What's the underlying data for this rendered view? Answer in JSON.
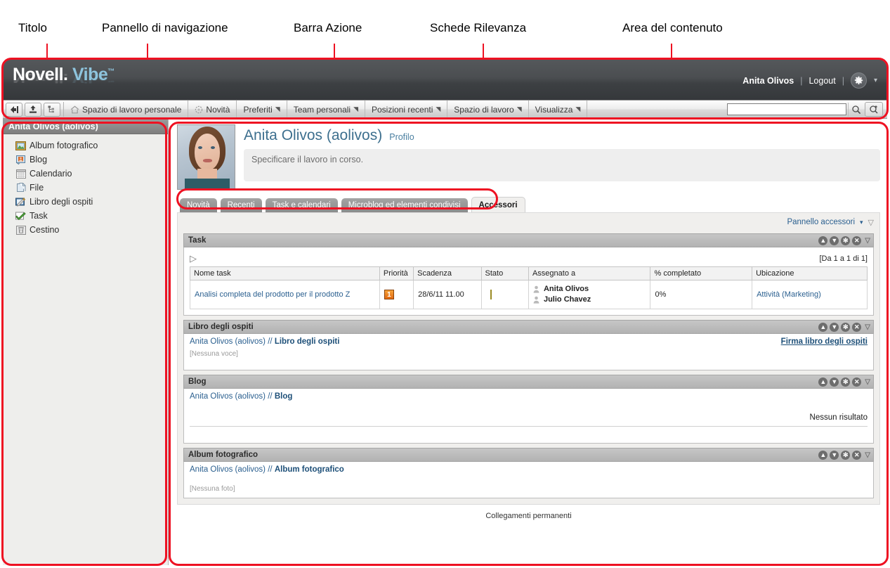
{
  "callouts": [
    {
      "label": "Titolo"
    },
    {
      "label": "Pannello di navigazione"
    },
    {
      "label": "Barra Azione"
    },
    {
      "label": "Schede Rilevanza"
    },
    {
      "label": "Area del contenuto"
    }
  ],
  "header": {
    "logo_brand": "Novell",
    "logo_dot": ".",
    "logo_product": "Vibe",
    "logo_tm": "™",
    "user": "Anita Olivos",
    "separator": "|",
    "logout": "Logout",
    "gear_icon": "gear-icon",
    "gear_caret": "▾"
  },
  "action_bar": {
    "icon_buttons": [
      {
        "name": "back-to-workspace-icon"
      },
      {
        "name": "upload-icon"
      },
      {
        "name": "workspace-tree-icon"
      }
    ],
    "items": [
      {
        "label": "Spazio di lavoro personale",
        "icon": "home-icon",
        "caret": ""
      },
      {
        "label": "Novità",
        "icon": "whats-new-icon",
        "caret": ""
      },
      {
        "label": "Preferiti",
        "icon": "",
        "caret": "◥"
      },
      {
        "label": "Team personali",
        "icon": "",
        "caret": "◥"
      },
      {
        "label": "Posizioni recenti",
        "icon": "",
        "caret": "◥"
      },
      {
        "label": "Spazio di lavoro",
        "icon": "",
        "caret": "◥"
      },
      {
        "label": "Visualizza",
        "icon": "",
        "caret": "◥"
      }
    ],
    "search_value": "",
    "search_placeholder": "",
    "search_icon": "search-icon",
    "advanced_search_icon": "advanced-search-icon"
  },
  "sidebar": {
    "title": "Anita Olivos (aolivos)",
    "items": [
      {
        "label": "Album fotografico",
        "icon": "photo-album-icon"
      },
      {
        "label": "Blog",
        "icon": "blog-icon"
      },
      {
        "label": "Calendario",
        "icon": "calendar-icon"
      },
      {
        "label": "File",
        "icon": "file-icon"
      },
      {
        "label": "Libro degli ospiti",
        "icon": "guestbook-icon"
      },
      {
        "label": "Task",
        "icon": "task-icon"
      },
      {
        "label": "Cestino",
        "icon": "trash-icon"
      }
    ]
  },
  "profile": {
    "avatar_alt": "avatar",
    "name": "Anita Olivos (aolivos)",
    "profile_link": "Profilo",
    "status_placeholder": "Specificare il lavoro in corso."
  },
  "tabs": [
    {
      "label": "Novità",
      "active": false
    },
    {
      "label": "Recenti",
      "active": false
    },
    {
      "label": "Task e calendari",
      "active": false
    },
    {
      "label": "Microblog ed elementi condivisi",
      "active": false
    },
    {
      "label": "Accessori",
      "active": true
    }
  ],
  "accessory_panel": {
    "link_label": "Pannello accessori",
    "link_caret": "▾",
    "collapse_caret": "▽"
  },
  "panel_icons": {
    "move_up": "arrow-up-icon",
    "move_down": "arrow-down-icon",
    "configure": "gear-icon",
    "close": "close-icon",
    "collapse": "collapse-icon"
  },
  "panels": {
    "task": {
      "title": "Task",
      "expander": "▷",
      "count_text": "[Da 1 a 1 di 1]",
      "columns": [
        "Nome task",
        "Priorità",
        "Scadenza",
        "Stato",
        "Assegnato a",
        "% completato",
        "Ubicazione"
      ],
      "rows": [
        {
          "name": "Analisi completa del prodotto per il prodotto Z",
          "priority": "1",
          "priority_icon": "priority-high-icon",
          "due": "28/6/11 11.00",
          "status_icon": "status-diamond-icon",
          "assignees": [
            "Anita Olivos",
            "Julio Chavez"
          ],
          "percent": "0%",
          "location": "Attività (Marketing)"
        }
      ]
    },
    "guestbook": {
      "title": "Libro degli ospiti",
      "crumb_owner": "Anita Olivos (aolivos) //",
      "crumb_leaf": "Libro degli ospiti",
      "action": "Firma libro degli ospiti",
      "empty": "[Nessuna voce]"
    },
    "blog": {
      "title": "Blog",
      "crumb_owner": "Anita Olivos (aolivos) //",
      "crumb_leaf": "Blog",
      "no_results": "Nessun risultato"
    },
    "photo_album": {
      "title": "Album fotografico",
      "crumb_owner": "Anita Olivos (aolivos) //",
      "crumb_leaf": "Album fotografico",
      "empty": "[Nessuna foto]"
    }
  },
  "footer": {
    "permalinks": "Collegamenti permanenti"
  },
  "colors": {
    "annotation_red": "#ee1122",
    "header_dark": "#4b4e51",
    "link_blue": "#2a5f8f",
    "vibe_blue": "#8ec4dd"
  }
}
